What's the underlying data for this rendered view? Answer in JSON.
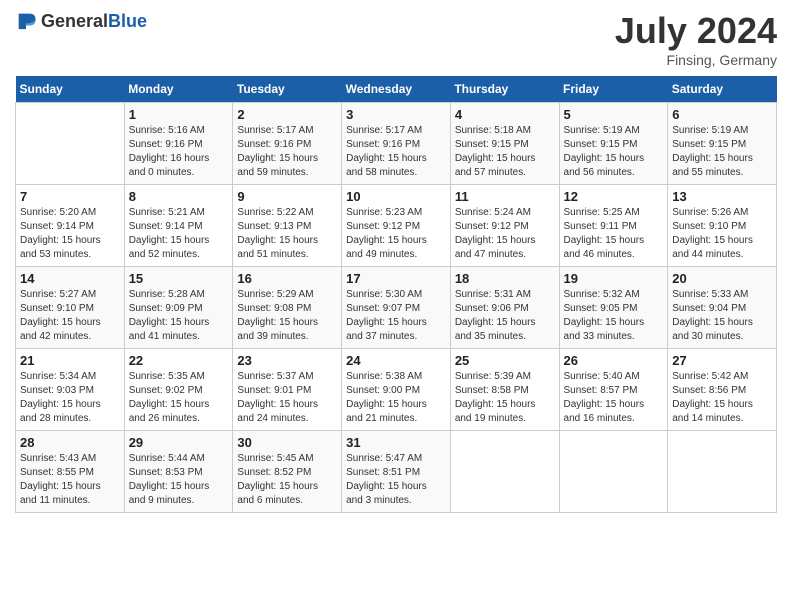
{
  "header": {
    "logo_general": "General",
    "logo_blue": "Blue",
    "title": "July 2024",
    "location": "Finsing, Germany"
  },
  "calendar": {
    "weekdays": [
      "Sunday",
      "Monday",
      "Tuesday",
      "Wednesday",
      "Thursday",
      "Friday",
      "Saturday"
    ],
    "weeks": [
      [
        {
          "day": "",
          "info": ""
        },
        {
          "day": "1",
          "info": "Sunrise: 5:16 AM\nSunset: 9:16 PM\nDaylight: 16 hours\nand 0 minutes."
        },
        {
          "day": "2",
          "info": "Sunrise: 5:17 AM\nSunset: 9:16 PM\nDaylight: 15 hours\nand 59 minutes."
        },
        {
          "day": "3",
          "info": "Sunrise: 5:17 AM\nSunset: 9:16 PM\nDaylight: 15 hours\nand 58 minutes."
        },
        {
          "day": "4",
          "info": "Sunrise: 5:18 AM\nSunset: 9:15 PM\nDaylight: 15 hours\nand 57 minutes."
        },
        {
          "day": "5",
          "info": "Sunrise: 5:19 AM\nSunset: 9:15 PM\nDaylight: 15 hours\nand 56 minutes."
        },
        {
          "day": "6",
          "info": "Sunrise: 5:19 AM\nSunset: 9:15 PM\nDaylight: 15 hours\nand 55 minutes."
        }
      ],
      [
        {
          "day": "7",
          "info": ""
        },
        {
          "day": "8",
          "info": "Sunrise: 5:21 AM\nSunset: 9:14 PM\nDaylight: 15 hours\nand 52 minutes."
        },
        {
          "day": "9",
          "info": "Sunrise: 5:22 AM\nSunset: 9:13 PM\nDaylight: 15 hours\nand 51 minutes."
        },
        {
          "day": "10",
          "info": "Sunrise: 5:23 AM\nSunset: 9:12 PM\nDaylight: 15 hours\nand 49 minutes."
        },
        {
          "day": "11",
          "info": "Sunrise: 5:24 AM\nSunset: 9:12 PM\nDaylight: 15 hours\nand 47 minutes."
        },
        {
          "day": "12",
          "info": "Sunrise: 5:25 AM\nSunset: 9:11 PM\nDaylight: 15 hours\nand 46 minutes."
        },
        {
          "day": "13",
          "info": "Sunrise: 5:26 AM\nSunset: 9:10 PM\nDaylight: 15 hours\nand 44 minutes."
        }
      ],
      [
        {
          "day": "14",
          "info": ""
        },
        {
          "day": "15",
          "info": "Sunrise: 5:28 AM\nSunset: 9:09 PM\nDaylight: 15 hours\nand 41 minutes."
        },
        {
          "day": "16",
          "info": "Sunrise: 5:29 AM\nSunset: 9:08 PM\nDaylight: 15 hours\nand 39 minutes."
        },
        {
          "day": "17",
          "info": "Sunrise: 5:30 AM\nSunset: 9:07 PM\nDaylight: 15 hours\nand 37 minutes."
        },
        {
          "day": "18",
          "info": "Sunrise: 5:31 AM\nSunset: 9:06 PM\nDaylight: 15 hours\nand 35 minutes."
        },
        {
          "day": "19",
          "info": "Sunrise: 5:32 AM\nSunset: 9:05 PM\nDaylight: 15 hours\nand 33 minutes."
        },
        {
          "day": "20",
          "info": "Sunrise: 5:33 AM\nSunset: 9:04 PM\nDaylight: 15 hours\nand 30 minutes."
        }
      ],
      [
        {
          "day": "21",
          "info": ""
        },
        {
          "day": "22",
          "info": "Sunrise: 5:35 AM\nSunset: 9:02 PM\nDaylight: 15 hours\nand 26 minutes."
        },
        {
          "day": "23",
          "info": "Sunrise: 5:37 AM\nSunset: 9:01 PM\nDaylight: 15 hours\nand 24 minutes."
        },
        {
          "day": "24",
          "info": "Sunrise: 5:38 AM\nSunset: 9:00 PM\nDaylight: 15 hours\nand 21 minutes."
        },
        {
          "day": "25",
          "info": "Sunrise: 5:39 AM\nSunset: 8:58 PM\nDaylight: 15 hours\nand 19 minutes."
        },
        {
          "day": "26",
          "info": "Sunrise: 5:40 AM\nSunset: 8:57 PM\nDaylight: 15 hours\nand 16 minutes."
        },
        {
          "day": "27",
          "info": "Sunrise: 5:42 AM\nSunset: 8:56 PM\nDaylight: 15 hours\nand 14 minutes."
        }
      ],
      [
        {
          "day": "28",
          "info": ""
        },
        {
          "day": "29",
          "info": "Sunrise: 5:44 AM\nSunset: 8:53 PM\nDaylight: 15 hours\nand 9 minutes."
        },
        {
          "day": "30",
          "info": "Sunrise: 5:45 AM\nSunset: 8:52 PM\nDaylight: 15 hours\nand 6 minutes."
        },
        {
          "day": "31",
          "info": "Sunrise: 5:47 AM\nSunset: 8:51 PM\nDaylight: 15 hours\nand 3 minutes."
        },
        {
          "day": "",
          "info": ""
        },
        {
          "day": "",
          "info": ""
        },
        {
          "day": "",
          "info": ""
        }
      ]
    ],
    "week1_day7_info": "Sunrise: 5:20 AM\nSunset: 9:14 PM\nDaylight: 15 hours\nand 53 minutes.",
    "week2_day14_info": "Sunrise: 5:27 AM\nSunset: 9:10 PM\nDaylight: 15 hours\nand 42 minutes.",
    "week3_day21_info": "Sunrise: 5:34 AM\nSunset: 9:03 PM\nDaylight: 15 hours\nand 28 minutes.",
    "week4_day28_info": "Sunrise: 5:43 AM\nSunset: 8:55 PM\nDaylight: 15 hours\nand 11 minutes."
  }
}
